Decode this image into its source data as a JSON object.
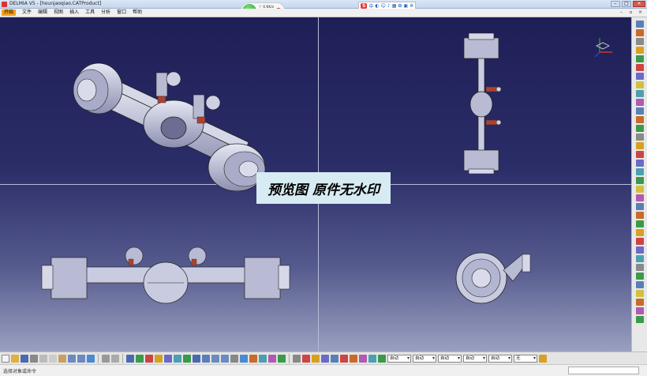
{
  "window": {
    "title": "DELMIA V5 - [hounjaoqiao.CATProduct]"
  },
  "menu": {
    "start": "开始",
    "items": [
      "文件",
      "编辑",
      "视图",
      "插入",
      "工具",
      "分析",
      "窗口",
      "帮助"
    ]
  },
  "speed_widget": {
    "percent": "88%",
    "up": "0.6K/s",
    "down": "0.6K/s"
  },
  "ime": {
    "logo": "S",
    "mode": "中"
  },
  "watermark": "预览图 原件无水印",
  "combos": [
    "自动",
    "自动",
    "自动",
    "自动",
    "自动",
    "无"
  ],
  "status": {
    "text": "选择对象或命令"
  },
  "colors": {
    "viewport_top": "#1f1f57",
    "viewport_bottom": "#9aa0c0",
    "model_metal": "#c9cbe0",
    "part_red": "#b04030"
  }
}
